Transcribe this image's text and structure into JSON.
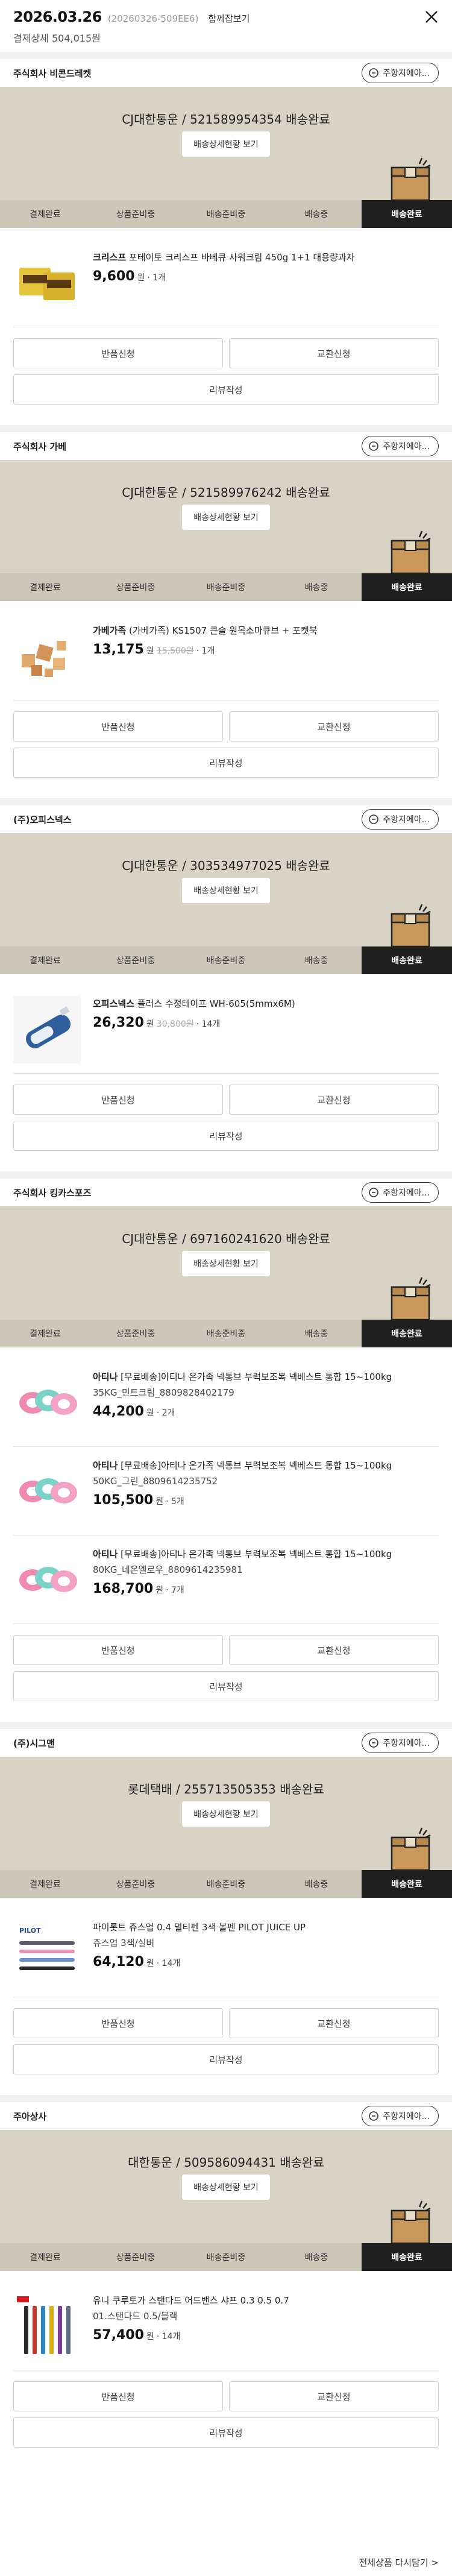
{
  "header": {
    "date": "2026.03.26",
    "order_no": "(20260326-509EE6)",
    "receipt_link": "함께잡보기",
    "payment_summary": "결제상세 504,015원"
  },
  "labels": {
    "inquiry": "주항지에아...",
    "ship_detail": "배송상세현황 보기",
    "return": "반품신청",
    "exchange": "교환신청",
    "review": "리뷰작성",
    "won": "원",
    "footer": "전체상품 다시담기 >"
  },
  "steps": [
    "결제완료",
    "상품준비중",
    "배송준비중",
    "배송중",
    "배송완료"
  ],
  "shipments": [
    {
      "seller": "주식회사 비콘드레켓",
      "status": "CJ대한통운 / 521589954354 배송완료",
      "products": [
        {
          "name_bold": "크리스프",
          "name": " 포테이토 크리스프 바베큐 사워크림 450g 1+1 대용량과자",
          "option": "",
          "price": "9,600",
          "original": "",
          "qty": "· 1개",
          "thumb": "snack-box"
        }
      ],
      "has_review": true
    },
    {
      "seller": "주식회사 가베",
      "status": "CJ대한통운 / 521589976242 배송완료",
      "products": [
        {
          "name_bold": "가베가족",
          "name": " (가베가족) KS1507 큰솔 원목소마큐브 + 포켓북",
          "option": "",
          "price": "13,175",
          "original": "15,500원",
          "qty": "· 1개",
          "thumb": "wood-blocks"
        }
      ],
      "has_review": true
    },
    {
      "seller": "(주)오피스넥스",
      "status": "CJ대한통운 / 303534977025 배송완료",
      "products": [
        {
          "name_bold": "오피스넥스",
          "name": " 플러스 수정테이프 WH-605(5mmx6M)",
          "option": "",
          "price": "26,320",
          "original": "30,800원",
          "qty": "· 14개",
          "thumb": "correction-tape"
        }
      ],
      "has_review": true
    },
    {
      "seller": "주식회사 킹카스포즈",
      "status": "CJ대한통운 / 697160241620 배송완료",
      "products": [
        {
          "name_bold": "아티나",
          "name": " [무료배송]아티나 온가족 넥통브 부력보조복 넥베스트 통합 15~100kg",
          "option": "35KG_민트크림_8809828402179",
          "price": "44,200",
          "original": "",
          "qty": "· 2개",
          "thumb": "neck-float"
        },
        {
          "name_bold": "아티나",
          "name": " [무료배송]아티나 온가족 넥통브 부력보조복 넥베스트 통합 15~100kg",
          "option": "50KG_그린_8809614235752",
          "price": "105,500",
          "original": "",
          "qty": "· 5개",
          "thumb": "neck-float"
        },
        {
          "name_bold": "아티나",
          "name": " [무료배송]아티나 온가족 넥통브 부력보조복 넥베스트 통합 15~100kg",
          "option": "80KG_네온엘로우_8809614235981",
          "price": "168,700",
          "original": "",
          "qty": "· 7개",
          "thumb": "neck-float"
        }
      ],
      "has_review": true
    },
    {
      "seller": "(주)시그맨",
      "status": "롯데택배 / 255713505353 배송완료",
      "products": [
        {
          "name_bold": "",
          "name": "파이롯트 쥬스업 0.4 멀티펜 3색 볼펜 PILOT JUICE UP",
          "option": "쥬스업 3색/실버",
          "price": "64,120",
          "original": "",
          "qty": "· 14개",
          "thumb": "pilot-pens"
        }
      ],
      "has_review": true
    },
    {
      "seller": "주아상사",
      "status": "대한통운 / 509586094431 배송완료",
      "products": [
        {
          "name_bold": "",
          "name": "유니 쿠루토가 스탠다드 어드밴스 샤프 0.3 0.5 0.7",
          "option": "01.스탠다드 0.5/블랙",
          "price": "57,400",
          "original": "",
          "qty": "· 14개",
          "thumb": "uni-pencils"
        }
      ],
      "has_review": true
    }
  ],
  "colors": {
    "panel": "#d9d3c6",
    "step_bar": "#cdc7b9",
    "active_step": "#1f1f1f"
  }
}
